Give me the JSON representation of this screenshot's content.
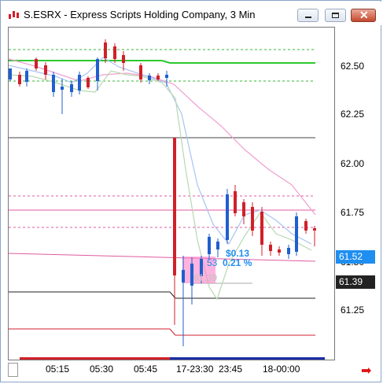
{
  "window": {
    "title": "S.ESRX - Express Scripts Holding Company, 3 Min"
  },
  "y_axis": {
    "ticks": [
      "62.50",
      "62.25",
      "62.00",
      "61.75",
      "61.50",
      "61.25"
    ]
  },
  "price_boxes": {
    "last": "61.52",
    "reference": "61.39"
  },
  "x_axis": {
    "ticks": [
      "05:15",
      "05:30",
      "05:45",
      "17-23:30",
      "23:45",
      "18-00:00"
    ]
  },
  "annotation": {
    "change": "$0.13",
    "percent_prefix": "53",
    "percent": "0.21 %",
    "hidden_label": "61.39"
  },
  "colors": {
    "up_candle": "#1f5fd0",
    "down_candle": "#d0202a",
    "last_price_box": "#1e8ef0",
    "ref_price_box": "#222222"
  }
}
